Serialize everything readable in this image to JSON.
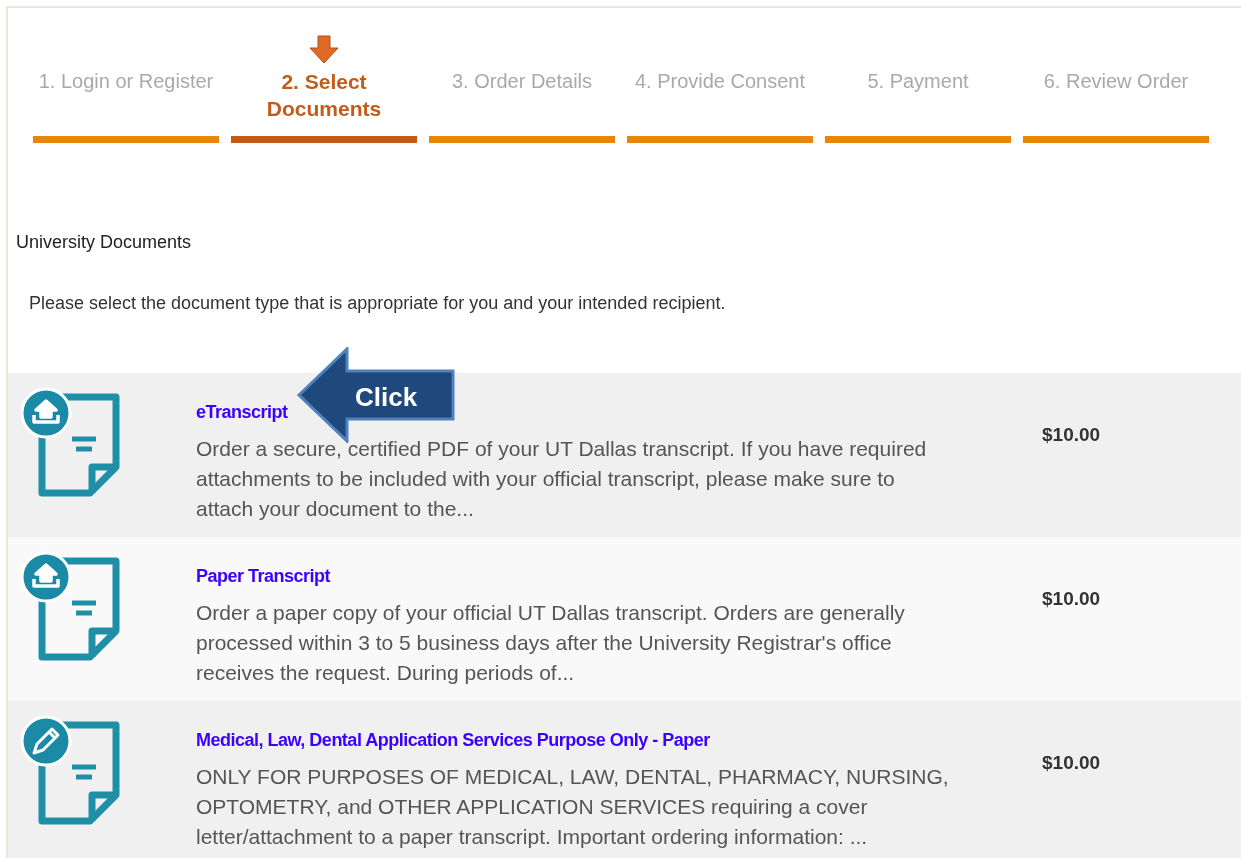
{
  "steps": [
    {
      "label": "1. Login or Register",
      "selected": false
    },
    {
      "label": "2. Select Documents",
      "selected": true
    },
    {
      "label": "3. Order Details",
      "selected": false
    },
    {
      "label": "4. Provide Consent",
      "selected": false
    },
    {
      "label": "5. Payment",
      "selected": false
    },
    {
      "label": "6. Review Order",
      "selected": false
    }
  ],
  "section_title": "University Documents",
  "instructions": "Please select the document type that is appropriate for you and your intended recipient.",
  "documents": [
    {
      "kind": "upload",
      "title": "eTranscript",
      "description": "Order a secure, certified PDF of your UT Dallas transcript. If you have required attachments to be included with your official transcript, please make sure to attach your document to the...",
      "price": "$10.00"
    },
    {
      "kind": "upload",
      "title": "Paper Transcript",
      "description": "Order a paper copy of your official UT Dallas transcript. Orders are generally processed within 3 to 5 business days after the University Registrar's office receives the request. During periods of...",
      "price": "$10.00"
    },
    {
      "kind": "pencil",
      "title": "Medical, Law, Dental Application Services Purpose Only - Paper",
      "description": "ONLY FOR PURPOSES OF MEDICAL, LAW, DENTAL, PHARMACY, NURSING, OPTOMETRY, and OTHER APPLICATION SERVICES requiring a cover letter/attachment to a paper transcript. Important ordering information: ...",
      "price": "$10.00"
    }
  ],
  "callout": {
    "text": "Click"
  }
}
